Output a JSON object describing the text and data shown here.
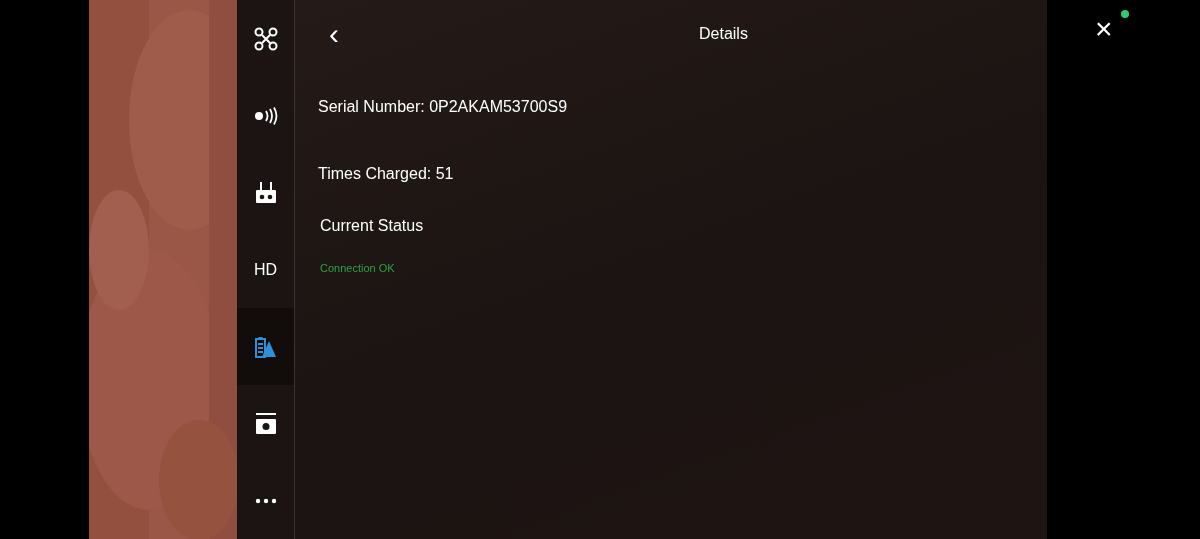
{
  "sidebar": {
    "items": [
      {
        "kind": "icon",
        "selected": false
      },
      {
        "kind": "icon",
        "selected": false
      },
      {
        "kind": "icon",
        "selected": false
      },
      {
        "kind": "text",
        "label": "HD",
        "selected": false
      },
      {
        "kind": "icon",
        "selected": true
      },
      {
        "kind": "icon",
        "selected": false
      },
      {
        "kind": "icon",
        "selected": false
      }
    ]
  },
  "header": {
    "back": "‹",
    "title": "Details",
    "close": "×"
  },
  "details": {
    "serial_number": "Serial Number: 0P2AKAM53700S9",
    "times_charged": "Times Charged: 51",
    "current_status_label": "Current Status",
    "current_status": "Connection OK"
  }
}
